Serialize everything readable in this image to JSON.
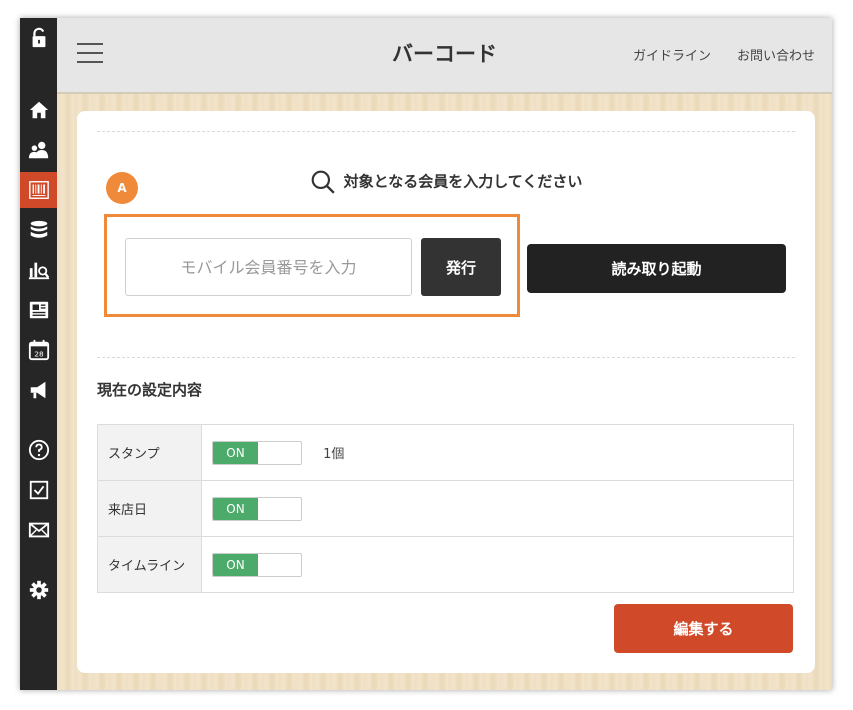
{
  "header": {
    "title": "バーコード",
    "links": [
      "ガイドライン",
      "お問い合わせ"
    ]
  },
  "sidebar": {
    "items": [
      {
        "icon": "unlock-icon"
      },
      {
        "icon": "home-icon"
      },
      {
        "icon": "users-icon"
      },
      {
        "icon": "barcode-icon",
        "active": true
      },
      {
        "icon": "database-icon"
      },
      {
        "icon": "analytics-icon"
      },
      {
        "icon": "news-icon"
      },
      {
        "icon": "calendar-icon",
        "text": "28"
      },
      {
        "icon": "megaphone-icon"
      },
      {
        "icon": "help-icon"
      },
      {
        "icon": "checkbox-icon"
      },
      {
        "icon": "mail-icon"
      },
      {
        "icon": "gear-icon"
      }
    ],
    "active_color": "#d04a2a"
  },
  "search": {
    "prompt": "対象となる会員を入力してください",
    "badge": "A",
    "placeholder": "モバイル会員番号を入力",
    "issue_label": "発行",
    "read_label": "読み取り起動",
    "highlight_color": "#ee8a3a"
  },
  "settings": {
    "title": "現在の設定内容",
    "rows": [
      {
        "label": "スタンプ",
        "toggle": "ON",
        "extra": "1個"
      },
      {
        "label": "来店日",
        "toggle": "ON",
        "extra": ""
      },
      {
        "label": "タイムライン",
        "toggle": "ON",
        "extra": ""
      }
    ],
    "edit_label": "編集する"
  }
}
